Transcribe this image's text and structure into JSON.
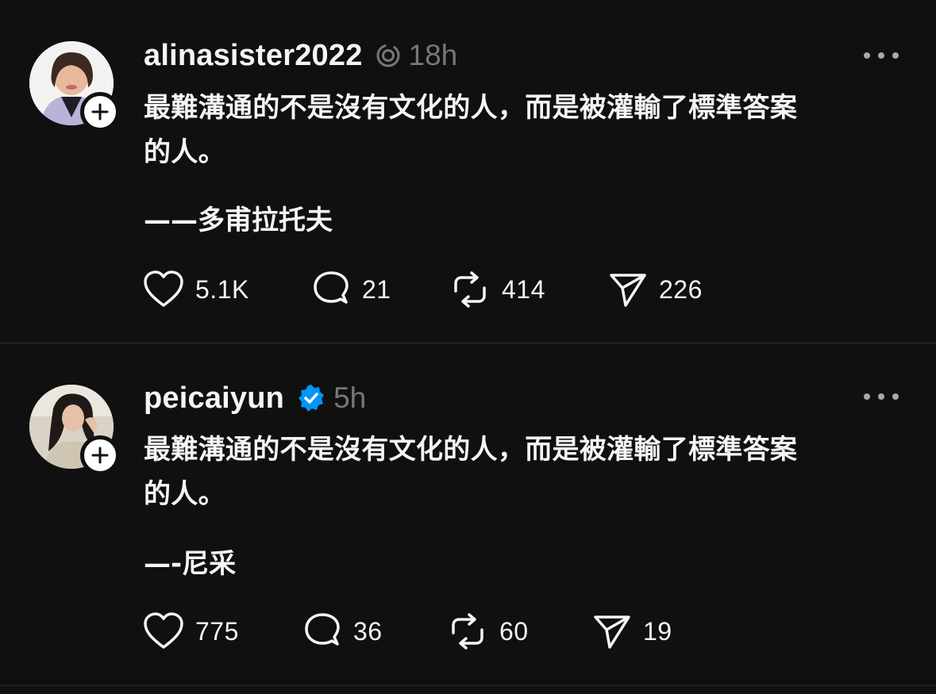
{
  "posts": [
    {
      "username": "alinasister2022",
      "timestamp": "18h",
      "badge_icon": "threads-ring-icon",
      "text_line1": "最難溝通的不是沒有文化的人，而是被灌輸了標準答案",
      "text_line2": "的人。",
      "author_line": "——多甫拉托夫",
      "likes": "5.1K",
      "replies": "21",
      "reposts": "414",
      "shares": "226"
    },
    {
      "username": "peicaiyun",
      "timestamp": "5h",
      "badge_icon": "verified-badge-icon",
      "badge_color": "#0095f6",
      "text_line1": "最難溝通的不是沒有文化的人，而是被灌輸了標準答案",
      "text_line2": "的人。",
      "author_line": "—-尼采",
      "likes": "775",
      "replies": "36",
      "reposts": "60",
      "shares": "19"
    }
  ],
  "colors": {
    "background": "#101010",
    "text": "#f3f5f7",
    "muted": "#777777",
    "divider": "#2d2d2d",
    "verified": "#0095f6"
  }
}
